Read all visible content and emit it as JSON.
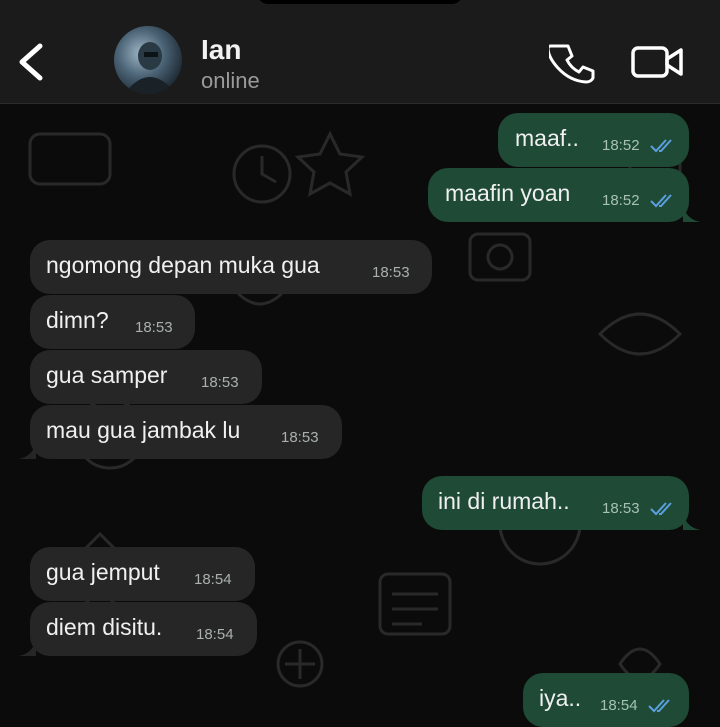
{
  "header": {
    "contact_name": "Ian",
    "status": "online"
  },
  "messages": [
    {
      "direction": "out",
      "text": "maaf..",
      "time": "18:52",
      "read": true
    },
    {
      "direction": "out",
      "text": "maafin yoan",
      "time": "18:52",
      "read": true
    },
    {
      "direction": "in",
      "text": "ngomong depan muka gua",
      "time": "18:53"
    },
    {
      "direction": "in",
      "text": "dimn?",
      "time": "18:53"
    },
    {
      "direction": "in",
      "text": "gua samper",
      "time": "18:53"
    },
    {
      "direction": "in",
      "text": "mau gua jambak lu",
      "time": "18:53"
    },
    {
      "direction": "out",
      "text": "ini di rumah..",
      "time": "18:53",
      "read": true
    },
    {
      "direction": "in",
      "text": "gua jemput",
      "time": "18:54"
    },
    {
      "direction": "in",
      "text": "diem disitu.",
      "time": "18:54"
    },
    {
      "direction": "out",
      "text": "iya..",
      "time": "18:54",
      "read": true
    }
  ],
  "colors": {
    "incoming_bubble": "#262626",
    "outgoing_bubble": "#1e4a36",
    "read_ticks": "#5aa0e0"
  }
}
